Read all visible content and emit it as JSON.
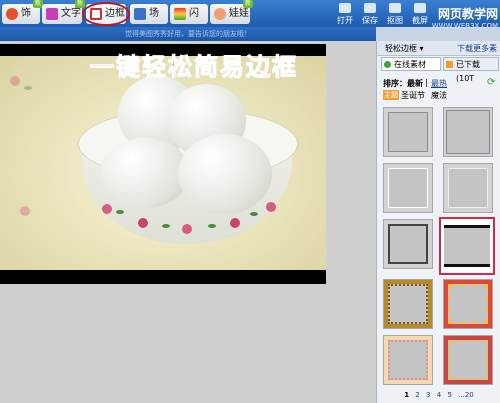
{
  "toolbar": {
    "tabs": [
      {
        "label": "饰品",
        "badge": "新"
      },
      {
        "label": "文字",
        "badge": "新"
      },
      {
        "label": "边框",
        "badge": ""
      },
      {
        "label": "场景",
        "badge": ""
      },
      {
        "label": "闪图",
        "badge": ""
      },
      {
        "label": "娃娃",
        "badge": "新"
      }
    ],
    "buttons": [
      "打开",
      "保存",
      "抠图",
      "截屏"
    ]
  },
  "watermark": {
    "main": "网页教学网",
    "sub": "WWW.WEB3X.COM"
  },
  "infobar_text": "觉得美图秀秀好用，要告诉您的朋友哦！",
  "overlay_title": "一键轻松简易边框",
  "panel": {
    "header_dropdown": "轻松边框 ▾",
    "header_link": "下载更多素",
    "tab_online": "在线素材",
    "tab_downloaded": "已下载(10T",
    "sort_label": "排序：",
    "sort_latest": "最新",
    "sort_hot": "最热",
    "filter_tag": "主题",
    "filter_items": [
      "圣诞节",
      "魔法"
    ],
    "pager": [
      "1",
      "2",
      "3",
      "4",
      "5",
      "...20"
    ]
  }
}
